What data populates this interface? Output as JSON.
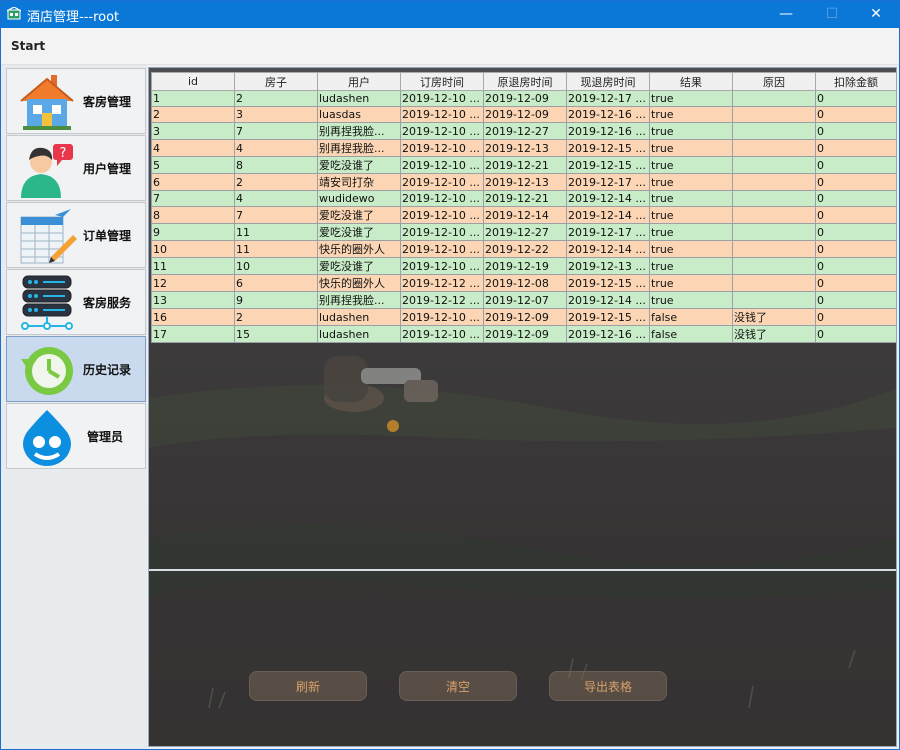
{
  "window": {
    "title": "酒店管理---root",
    "minimize": "—",
    "maximize": "☐",
    "close": "✕"
  },
  "menubar": {
    "start": "Start"
  },
  "sidebar": {
    "items": [
      {
        "label": "客房管理",
        "icon": "house-icon"
      },
      {
        "label": "用户管理",
        "icon": "user-question-icon"
      },
      {
        "label": "订单管理",
        "icon": "order-list-icon"
      },
      {
        "label": "客房服务",
        "icon": "server-icon"
      },
      {
        "label": "历史记录",
        "icon": "history-icon",
        "active": true
      },
      {
        "label": "管理员",
        "icon": "drupal-drop-icon"
      }
    ]
  },
  "table": {
    "headers": [
      "id",
      "房子",
      "用户",
      "订房时间",
      "原退房时间",
      "现退房时间",
      "结果",
      "原因",
      "扣除金额"
    ],
    "rows": [
      [
        "1",
        "2",
        "ludashen",
        "2019-12-10 ...",
        "2019-12-09",
        "2019-12-17 ...",
        "true",
        "",
        "0"
      ],
      [
        "2",
        "3",
        "luasdas",
        "2019-12-10 ...",
        "2019-12-09",
        "2019-12-16 ...",
        "true",
        "",
        "0"
      ],
      [
        "3",
        "7",
        "别再捏我脸...",
        "2019-12-10 ...",
        "2019-12-27",
        "2019-12-16 ...",
        "true",
        "",
        "0"
      ],
      [
        "4",
        "4",
        "别再捏我脸...",
        "2019-12-10 ...",
        "2019-12-13",
        "2019-12-15 ...",
        "true",
        "",
        "0"
      ],
      [
        "5",
        "8",
        "爱吃没谁了",
        "2019-12-10 ...",
        "2019-12-21",
        "2019-12-15 ...",
        "true",
        "",
        "0"
      ],
      [
        "6",
        "2",
        "靖安司打杂",
        "2019-12-10 ...",
        "2019-12-13",
        "2019-12-17 ...",
        "true",
        "",
        "0"
      ],
      [
        "7",
        "4",
        "wudidewo",
        "2019-12-10 ...",
        "2019-12-21",
        "2019-12-14 ...",
        "true",
        "",
        "0"
      ],
      [
        "8",
        "7",
        "爱吃没谁了",
        "2019-12-10 ...",
        "2019-12-14",
        "2019-12-14 ...",
        "true",
        "",
        "0"
      ],
      [
        "9",
        "11",
        "爱吃没谁了",
        "2019-12-10 ...",
        "2019-12-27",
        "2019-12-17 ...",
        "true",
        "",
        "0"
      ],
      [
        "10",
        "11",
        "快乐的圈外人",
        "2019-12-10 ...",
        "2019-12-22",
        "2019-12-14 ...",
        "true",
        "",
        "0"
      ],
      [
        "11",
        "10",
        "爱吃没谁了",
        "2019-12-10 ...",
        "2019-12-19",
        "2019-12-13 ...",
        "true",
        "",
        "0"
      ],
      [
        "12",
        "6",
        "快乐的圈外人",
        "2019-12-12 ...",
        "2019-12-08",
        "2019-12-15 ...",
        "true",
        "",
        "0"
      ],
      [
        "13",
        "9",
        "别再捏我脸...",
        "2019-12-12 ...",
        "2019-12-07",
        "2019-12-14 ...",
        "true",
        "",
        "0"
      ],
      [
        "16",
        "2",
        "ludashen",
        "2019-12-10 ...",
        "2019-12-09",
        "2019-12-15 ...",
        "false",
        "没钱了",
        "0"
      ],
      [
        "17",
        "15",
        "ludashen",
        "2019-12-10 ...",
        "2019-12-09",
        "2019-12-16 ...",
        "false",
        "没钱了",
        "0"
      ]
    ]
  },
  "actions": {
    "refresh": "刷新",
    "clear": "清空",
    "export": "导出表格"
  },
  "colors": {
    "row_green": "#c8ecc8",
    "row_orange": "#fcd6b4",
    "titlebar": "#0b78d7",
    "button_text": "#d7a06a"
  }
}
